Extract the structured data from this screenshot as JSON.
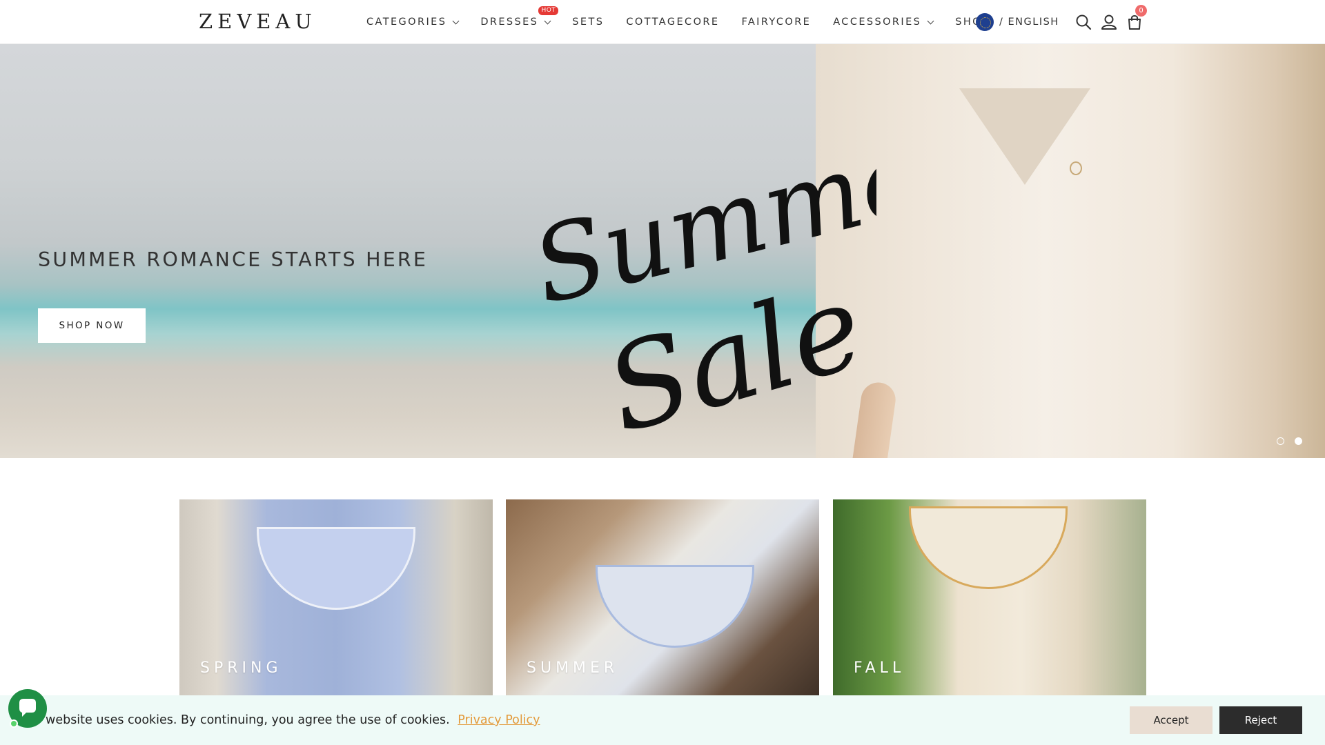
{
  "header": {
    "logo": "ZEVEAU",
    "nav": [
      {
        "label": "CATEGORIES",
        "dropdown": true
      },
      {
        "label": "DRESSES",
        "dropdown": true,
        "badge": "HOT"
      },
      {
        "label": "SETS",
        "dropdown": false
      },
      {
        "label": "COTTAGECORE",
        "dropdown": false
      },
      {
        "label": "FAIRYCORE",
        "dropdown": false
      },
      {
        "label": "ACCESSORIES",
        "dropdown": true
      },
      {
        "label": "SHOE",
        "dropdown": false
      }
    ],
    "language": "/ ENGLISH",
    "cart_count": "0",
    "icons": [
      "globe-icon",
      "search-icon",
      "user-icon",
      "cart-icon"
    ]
  },
  "hero": {
    "title": "SUMMER ROMANCE STARTS HERE",
    "script_line1": "Summer",
    "script_line2": "Sale",
    "cta": "SHOP NOW",
    "slides": 2,
    "active_slide": 2
  },
  "seasons": [
    {
      "label": "SPRING"
    },
    {
      "label": "SUMMER"
    },
    {
      "label": "FALL"
    }
  ],
  "cookie": {
    "text": "website uses cookies. By continuing, you agree the use of cookies.",
    "link": "Privacy Policy",
    "accept": "Accept",
    "reject": "Reject"
  },
  "colors": {
    "hot_badge": "#e53935",
    "cart_badge": "#ef6b6b",
    "cookie_bg": "#eefaf7",
    "link": "#e39a3b",
    "accept_bg": "#e9ddd2",
    "reject_bg": "#2c2c2c",
    "chat": "#1f8f45"
  }
}
